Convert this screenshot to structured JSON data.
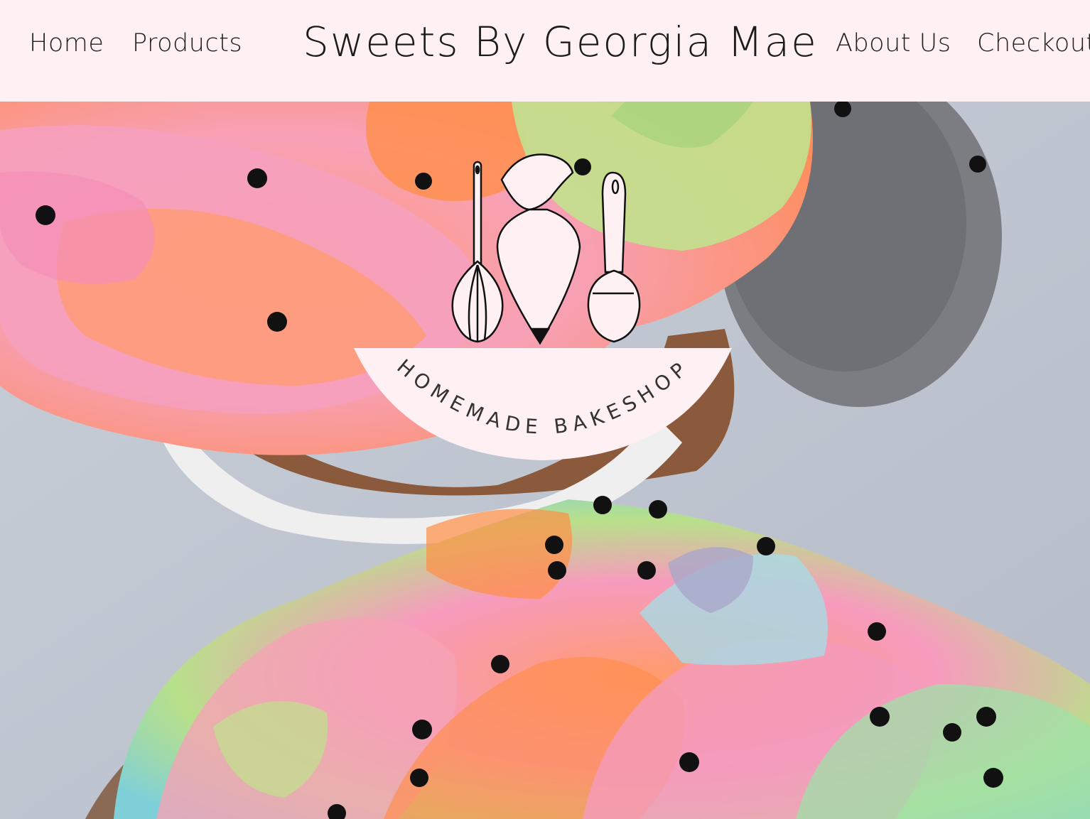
{
  "header": {
    "background": "#fff1f3",
    "site_title": "Sweets By Georgia Mae",
    "nav_left": [
      {
        "label": "Home"
      },
      {
        "label": "Products"
      }
    ],
    "nav_right": [
      {
        "label": "About Us"
      },
      {
        "label": "Checkout"
      }
    ]
  },
  "hero": {
    "image": "rainbow-frosted-cupcakes-photo",
    "logo": {
      "icons": [
        "whisk-icon",
        "piping-bag-icon",
        "spoon-icon"
      ],
      "banner_text": "HOMEMADE BAKESHOP",
      "banner_color": "#fff1f3"
    }
  }
}
